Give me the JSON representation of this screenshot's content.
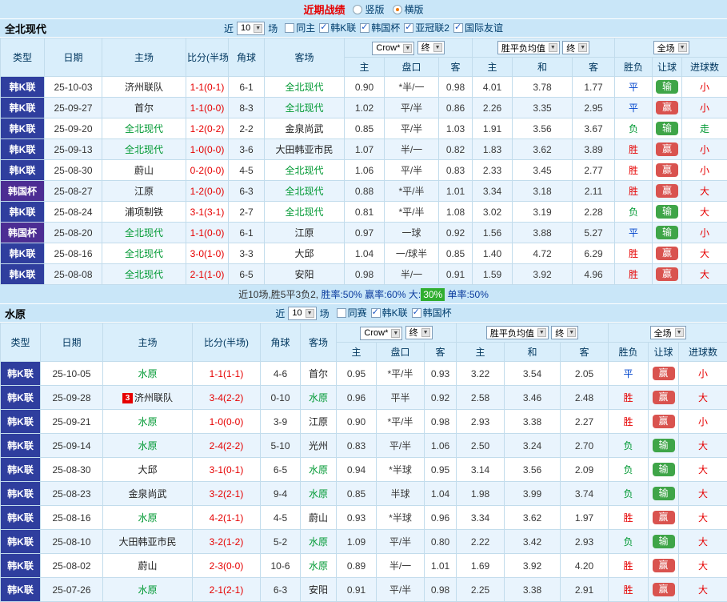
{
  "topbar": {
    "title": "近期战绩",
    "options": [
      {
        "label": "竖版",
        "selected": false
      },
      {
        "label": "横版",
        "selected": true
      }
    ]
  },
  "columns": {
    "type": "类型",
    "date": "日期",
    "home": "主场",
    "score": "比分(半场)",
    "corner": "角球",
    "away": "客场",
    "odds_home": "主",
    "odds_line": "盘口",
    "odds_away": "客",
    "avg_home": "主",
    "avg_draw": "和",
    "avg_away": "客",
    "res_wdl": "胜负",
    "res_handicap": "让球",
    "res_goals": "进球数"
  },
  "dropdowns": {
    "bookmaker": "Crow*",
    "final": "终",
    "avg": "胜平负均值",
    "scope": "全场"
  },
  "colors": {
    "league_bg": {
      "韩K联": "#2f3e9e",
      "韩国杯": "#4c2d93"
    },
    "focus_team": "#009933",
    "score": "#e60000",
    "wdl": {
      "胜": "#e60000",
      "平": "#0044cc",
      "负": "#009933"
    },
    "handicap_bg": {
      "赢": "#d9534f",
      "输": "#3fa548",
      "走": "#3a7bd5"
    },
    "goal": {
      "大": "#e60000",
      "小": "#e60000",
      "走": "#009933"
    }
  },
  "sections": [
    {
      "team": "全北现代",
      "filter": {
        "near": "近",
        "count": "10",
        "unit": "场",
        "checkboxes": [
          {
            "label": "同主",
            "checked": false
          },
          {
            "label": "韩K联",
            "checked": true
          },
          {
            "label": "韩国杯",
            "checked": true
          },
          {
            "label": "亚冠联2",
            "checked": true
          },
          {
            "label": "国际友谊",
            "checked": true
          }
        ]
      },
      "rows": [
        {
          "league": "韩K联",
          "date": "25-10-03",
          "home": "济州联队",
          "home_focus": false,
          "score": "1-1(0-1)",
          "corner": "6-1",
          "away": "全北现代",
          "away_focus": true,
          "o1": "0.90",
          "line": "*半/一",
          "o2": "0.98",
          "a1": "4.01",
          "a2": "3.78",
          "a3": "1.77",
          "wdl": "平",
          "hc": "输",
          "goal": "小"
        },
        {
          "league": "韩K联",
          "date": "25-09-27",
          "home": "首尔",
          "home_focus": false,
          "score": "1-1(0-0)",
          "corner": "8-3",
          "away": "全北现代",
          "away_focus": true,
          "o1": "1.02",
          "line": "平/半",
          "o2": "0.86",
          "a1": "2.26",
          "a2": "3.35",
          "a3": "2.95",
          "wdl": "平",
          "hc": "赢",
          "goal": "小"
        },
        {
          "league": "韩K联",
          "date": "25-09-20",
          "home": "全北现代",
          "home_focus": true,
          "score": "1-2(0-2)",
          "corner": "2-2",
          "away": "金泉尚武",
          "away_focus": false,
          "o1": "0.85",
          "line": "平/半",
          "o2": "1.03",
          "a1": "1.91",
          "a2": "3.56",
          "a3": "3.67",
          "wdl": "负",
          "hc": "输",
          "goal": "走"
        },
        {
          "league": "韩K联",
          "date": "25-09-13",
          "home": "全北现代",
          "home_focus": true,
          "score": "1-0(0-0)",
          "corner": "3-6",
          "away": "大田韩亚市民",
          "away_focus": false,
          "o1": "1.07",
          "line": "半/一",
          "o2": "0.82",
          "a1": "1.83",
          "a2": "3.62",
          "a3": "3.89",
          "wdl": "胜",
          "hc": "赢",
          "goal": "小"
        },
        {
          "league": "韩K联",
          "date": "25-08-30",
          "home": "蔚山",
          "home_focus": false,
          "score": "0-2(0-0)",
          "corner": "4-5",
          "away": "全北现代",
          "away_focus": true,
          "o1": "1.06",
          "line": "平/半",
          "o2": "0.83",
          "a1": "2.33",
          "a2": "3.45",
          "a3": "2.77",
          "wdl": "胜",
          "hc": "赢",
          "goal": "小"
        },
        {
          "league": "韩国杯",
          "date": "25-08-27",
          "home": "江原",
          "home_focus": false,
          "score": "1-2(0-0)",
          "corner": "6-3",
          "away": "全北现代",
          "away_focus": true,
          "o1": "0.88",
          "line": "*平/半",
          "o2": "1.01",
          "a1": "3.34",
          "a2": "3.18",
          "a3": "2.11",
          "wdl": "胜",
          "hc": "赢",
          "goal": "大"
        },
        {
          "league": "韩K联",
          "date": "25-08-24",
          "home": "浦项制铁",
          "home_focus": false,
          "score": "3-1(3-1)",
          "corner": "2-7",
          "away": "全北现代",
          "away_focus": true,
          "o1": "0.81",
          "line": "*平/半",
          "o2": "1.08",
          "a1": "3.02",
          "a2": "3.19",
          "a3": "2.28",
          "wdl": "负",
          "hc": "输",
          "goal": "大"
        },
        {
          "league": "韩国杯",
          "date": "25-08-20",
          "home": "全北现代",
          "home_focus": true,
          "score": "1-1(0-0)",
          "corner": "6-1",
          "away": "江原",
          "away_focus": false,
          "o1": "0.97",
          "line": "一球",
          "o2": "0.92",
          "a1": "1.56",
          "a2": "3.88",
          "a3": "5.27",
          "wdl": "平",
          "hc": "输",
          "goal": "小"
        },
        {
          "league": "韩K联",
          "date": "25-08-16",
          "home": "全北现代",
          "home_focus": true,
          "score": "3-0(1-0)",
          "corner": "3-3",
          "away": "大邱",
          "away_focus": false,
          "o1": "1.04",
          "line": "一/球半",
          "o2": "0.85",
          "a1": "1.40",
          "a2": "4.72",
          "a3": "6.29",
          "wdl": "胜",
          "hc": "赢",
          "goal": "大"
        },
        {
          "league": "韩K联",
          "date": "25-08-08",
          "home": "全北现代",
          "home_focus": true,
          "score": "2-1(1-0)",
          "corner": "6-5",
          "away": "安阳",
          "away_focus": false,
          "o1": "0.98",
          "line": "半/一",
          "o2": "0.91",
          "a1": "1.59",
          "a2": "3.92",
          "a3": "4.96",
          "wdl": "胜",
          "hc": "赢",
          "goal": "大"
        }
      ],
      "summary": {
        "parts": [
          {
            "text": "近10场,胜5平3负2, ",
            "color": "#333333"
          },
          {
            "text": "胜率:50% 赢率:60% 大:",
            "color": "#0b3c9e"
          },
          {
            "text": "30%",
            "color": "#ffffff",
            "bg": "#2fae2f"
          },
          {
            "text": " 单率:50%",
            "color": "#0b3c9e"
          }
        ]
      }
    },
    {
      "team": "水原",
      "filter": {
        "near": "近",
        "count": "10",
        "unit": "场",
        "checkboxes": [
          {
            "label": "同赛",
            "checked": false
          },
          {
            "label": "韩K联",
            "checked": true
          },
          {
            "label": "韩国杯",
            "checked": true
          }
        ]
      },
      "rows": [
        {
          "league": "韩K联",
          "date": "25-10-05",
          "home": "水原",
          "home_focus": true,
          "score": "1-1(1-1)",
          "corner": "4-6",
          "away": "首尔",
          "away_focus": false,
          "o1": "0.95",
          "line": "*平/半",
          "o2": "0.93",
          "a1": "3.22",
          "a2": "3.54",
          "a3": "2.05",
          "wdl": "平",
          "hc": "赢",
          "goal": "小"
        },
        {
          "league": "韩K联",
          "date": "25-09-28",
          "home": "济州联队",
          "home_badge": "3",
          "home_focus": false,
          "score": "3-4(2-2)",
          "corner": "0-10",
          "away": "水原",
          "away_focus": true,
          "o1": "0.96",
          "line": "平半",
          "o2": "0.92",
          "a1": "2.58",
          "a2": "3.46",
          "a3": "2.48",
          "wdl": "胜",
          "hc": "赢",
          "goal": "大"
        },
        {
          "league": "韩K联",
          "date": "25-09-21",
          "home": "水原",
          "home_focus": true,
          "score": "1-0(0-0)",
          "corner": "3-9",
          "away": "江原",
          "away_focus": false,
          "o1": "0.90",
          "line": "*平/半",
          "o2": "0.98",
          "a1": "2.93",
          "a2": "3.38",
          "a3": "2.27",
          "wdl": "胜",
          "hc": "赢",
          "goal": "小"
        },
        {
          "league": "韩K联",
          "date": "25-09-14",
          "home": "水原",
          "home_focus": true,
          "score": "2-4(2-2)",
          "corner": "5-10",
          "away": "光州",
          "away_focus": false,
          "o1": "0.83",
          "line": "平/半",
          "o2": "1.06",
          "a1": "2.50",
          "a2": "3.24",
          "a3": "2.70",
          "wdl": "负",
          "hc": "输",
          "goal": "大"
        },
        {
          "league": "韩K联",
          "date": "25-08-30",
          "home": "大邱",
          "home_focus": false,
          "score": "3-1(0-1)",
          "corner": "6-5",
          "away": "水原",
          "away_focus": true,
          "o1": "0.94",
          "line": "*半球",
          "o2": "0.95",
          "a1": "3.14",
          "a2": "3.56",
          "a3": "2.09",
          "wdl": "负",
          "hc": "输",
          "goal": "大"
        },
        {
          "league": "韩K联",
          "date": "25-08-23",
          "home": "金泉尚武",
          "home_focus": false,
          "score": "3-2(2-1)",
          "corner": "9-4",
          "away": "水原",
          "away_focus": true,
          "o1": "0.85",
          "line": "半球",
          "o2": "1.04",
          "a1": "1.98",
          "a2": "3.99",
          "a3": "3.74",
          "wdl": "负",
          "hc": "输",
          "goal": "大"
        },
        {
          "league": "韩K联",
          "date": "25-08-16",
          "home": "水原",
          "home_focus": true,
          "score": "4-2(1-1)",
          "corner": "4-5",
          "away": "蔚山",
          "away_focus": false,
          "o1": "0.93",
          "line": "*半球",
          "o2": "0.96",
          "a1": "3.34",
          "a2": "3.62",
          "a3": "1.97",
          "wdl": "胜",
          "hc": "赢",
          "goal": "大"
        },
        {
          "league": "韩K联",
          "date": "25-08-10",
          "home": "大田韩亚市民",
          "home_focus": false,
          "score": "3-2(1-2)",
          "corner": "5-2",
          "away": "水原",
          "away_focus": true,
          "o1": "1.09",
          "line": "平/半",
          "o2": "0.80",
          "a1": "2.22",
          "a2": "3.42",
          "a3": "2.93",
          "wdl": "负",
          "hc": "输",
          "goal": "大"
        },
        {
          "league": "韩K联",
          "date": "25-08-02",
          "home": "蔚山",
          "home_focus": false,
          "score": "2-3(0-0)",
          "corner": "10-6",
          "away": "水原",
          "away_focus": true,
          "o1": "0.89",
          "line": "半/一",
          "o2": "1.01",
          "a1": "1.69",
          "a2": "3.92",
          "a3": "4.20",
          "wdl": "胜",
          "hc": "赢",
          "goal": "大"
        },
        {
          "league": "韩K联",
          "date": "25-07-26",
          "home": "水原",
          "home_focus": true,
          "score": "2-1(2-1)",
          "corner": "6-3",
          "away": "安阳",
          "away_focus": false,
          "o1": "0.91",
          "line": "平/半",
          "o2": "0.98",
          "a1": "2.25",
          "a2": "3.38",
          "a3": "2.91",
          "wdl": "胜",
          "hc": "赢",
          "goal": "大"
        }
      ]
    }
  ]
}
